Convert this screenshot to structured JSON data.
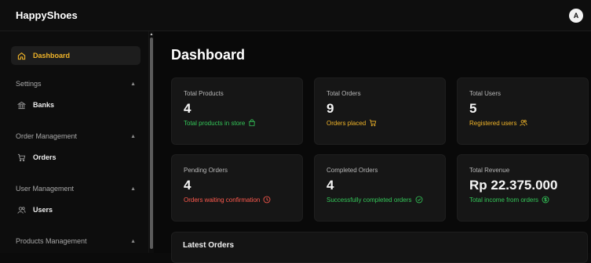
{
  "app": {
    "brand": "HappyShoes",
    "avatar_initial": "A"
  },
  "sidebar": {
    "active_item": {
      "label": "Dashboard",
      "icon": "home-icon"
    },
    "sections": [
      {
        "title": "Settings",
        "items": [
          {
            "label": "Banks",
            "icon": "bank-icon"
          }
        ]
      },
      {
        "title": "Order Management",
        "items": [
          {
            "label": "Orders",
            "icon": "cart-icon"
          }
        ]
      },
      {
        "title": "User Management",
        "items": [
          {
            "label": "Users",
            "icon": "users-icon"
          }
        ]
      },
      {
        "title": "Products Management",
        "items": []
      }
    ]
  },
  "main": {
    "title": "Dashboard",
    "cards": [
      {
        "label": "Total Products",
        "value": "4",
        "sub": "Total products in store",
        "color": "#34c759",
        "icon": "shopping-bag-icon"
      },
      {
        "label": "Total Orders",
        "value": "9",
        "sub": "Orders placed",
        "color": "#f0b429",
        "icon": "cart-icon"
      },
      {
        "label": "Total Users",
        "value": "5",
        "sub": "Registered users",
        "color": "#f0b429",
        "icon": "users-icon"
      },
      {
        "label": "Pending Orders",
        "value": "4",
        "sub": "Orders waiting confirmation",
        "color": "#ff5a4e",
        "icon": "clock-icon"
      },
      {
        "label": "Completed Orders",
        "value": "4",
        "sub": "Successfully completed orders",
        "color": "#34c759",
        "icon": "check-circle-icon"
      },
      {
        "label": "Total Revenue",
        "value": "Rp 22.375.000",
        "sub": "Total income from orders",
        "color": "#34c759",
        "icon": "dollar-circle-icon"
      }
    ],
    "latest_orders": {
      "title": "Latest Orders"
    }
  },
  "colors": {
    "accent": "#f0b429",
    "success": "#34c759",
    "danger": "#ff5a4e",
    "background": "#0b0b0b",
    "card": "#161616"
  }
}
